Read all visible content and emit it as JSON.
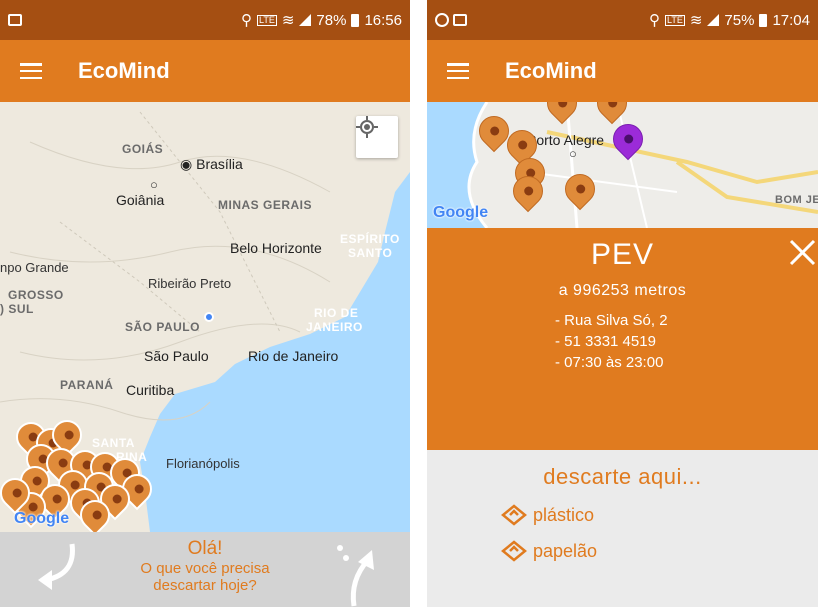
{
  "left_screen": {
    "status_bar": {
      "battery": "78%",
      "time": "16:56",
      "network": "LTE"
    },
    "app_bar": {
      "title": "EcoMind",
      "menu_icon": "hamburger-icon"
    },
    "map": {
      "labels": {
        "goias": "GOIÁS",
        "brasilia": "Brasília",
        "goiania": "Goiânia",
        "minas_gerais": "MINAS GERAIS",
        "belo_horizonte": "Belo Horizonte",
        "espirito_santo_1": "ESPÍRITO",
        "espirito_santo_2": "SANTO",
        "campo_grande": "npo Grande",
        "mato_grosso_1": "GROSSO",
        "mato_grosso_2": ") SUL",
        "ribeirao_preto": "Ribeirão Preto",
        "sao_paulo_state": "SÃO PAULO",
        "rio_state_1": "RIO DE",
        "rio_state_2": "JANEIRO",
        "sao_paulo": "São Paulo",
        "rio_de_janeiro": "Rio de Janeiro",
        "parana": "PARANÁ",
        "curitiba": "Curitiba",
        "santa_catarina_1": "SANTA",
        "santa_catarina_2": "RINA",
        "florianopolis": "Florianópolis"
      },
      "google": "Google",
      "locate_icon": "my-location-icon"
    },
    "greeting": {
      "hello": "Olá!",
      "line1": "O que você precisa",
      "line2": "descartar hoje?"
    }
  },
  "right_screen": {
    "status_bar": {
      "battery": "75%",
      "time": "17:04",
      "network": "LTE"
    },
    "app_bar": {
      "title": "EcoMind",
      "menu_icon": "hamburger-icon"
    },
    "map": {
      "labels": {
        "porto_alegre": "Porto Alegre",
        "bom_jesus": "BOM JES"
      },
      "google": "Google"
    },
    "pev": {
      "title": "PEV",
      "distance": "a 996253 metros",
      "address": "- Rua Silva Só, 2",
      "phone": "- 51 3331 4519",
      "hours": "- 07:30 às 23:00",
      "close_icon": "close-icon"
    },
    "discard": {
      "title": "descarte aqui...",
      "items": [
        "plástico",
        "papelão"
      ],
      "item_icon": "recycle-icon"
    }
  },
  "colors": {
    "status_bar": "#a54f12",
    "app_bar": "#e07b1f",
    "accent": "#e07b1f",
    "pin": "#e08b3a",
    "pin_selected": "#9b2bd8",
    "ocean": "#aadaff",
    "greeting_bg": "#d3d3d3",
    "discard_bg": "#ebebeb"
  }
}
